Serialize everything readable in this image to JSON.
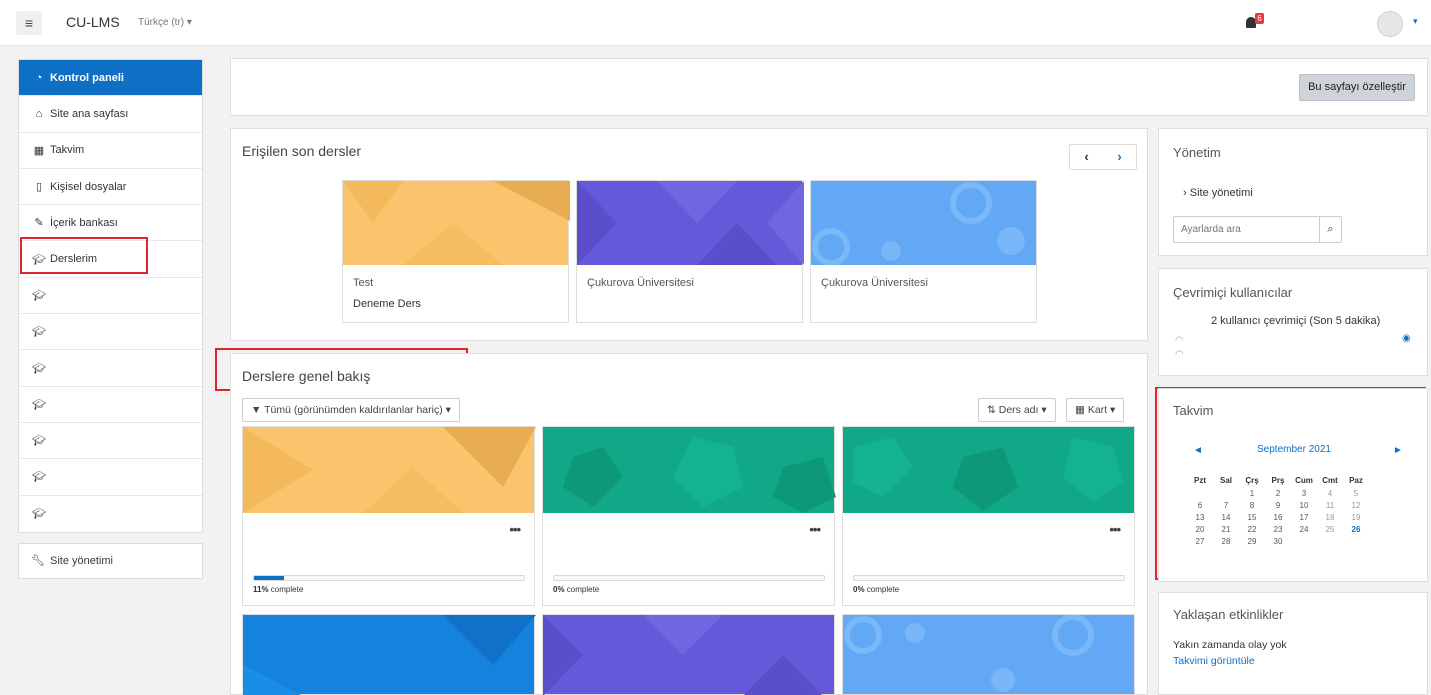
{
  "navbar": {
    "menu_icon": "hamburger-icon",
    "brand": "CU-LMS",
    "language": "Türkçe ‎(tr)‎",
    "language_caret": "▾",
    "notifications_count": "6",
    "user_caret": "▾"
  },
  "leftnav": {
    "dashboard": "Kontrol paneli",
    "items": [
      {
        "label": "Site ana sayfası",
        "icon": "home-icon"
      },
      {
        "label": "Takvim",
        "icon": "calendar-icon"
      },
      {
        "label": "Kişisel dosyalar",
        "icon": "file-icon"
      },
      {
        "label": "İçerik bankası",
        "icon": "brush-icon"
      },
      {
        "label": "Derslerim",
        "icon": "graduation-cap-icon"
      }
    ],
    "course_icon_count": 7,
    "site_admin": "Site yönetimi"
  },
  "customize_button": "Bu sayfayı özelleştir",
  "recent": {
    "title": "Erişilen son dersler",
    "prev": "‹",
    "next": "›",
    "courses": [
      {
        "category": "Test",
        "name": "Deneme Ders",
        "color": "#f9c46b"
      },
      {
        "category": "Çukurova Üniversitesi",
        "name": "",
        "color": "#6559d9"
      },
      {
        "category": "Çukurova Üniversitesi",
        "name": "",
        "color": "#62a8f5"
      }
    ]
  },
  "overview": {
    "title": "Derslere genel bakış",
    "filter": "Tümü (görünümden kaldırılanlar hariç)",
    "sort": "Ders adı",
    "view": "Kart",
    "courses": [
      {
        "color": "#f9c46b",
        "progress": 11,
        "pct_num": "11%",
        "pct_text": " complete"
      },
      {
        "color": "#10a886",
        "progress": 0,
        "pct_num": "0%",
        "pct_text": " complete"
      },
      {
        "color": "#10a886",
        "progress": 0,
        "pct_num": "0%",
        "pct_text": " complete"
      }
    ],
    "bottom_colors": [
      "#1582dd",
      "#6559d9",
      "#62a8f5"
    ]
  },
  "admin_block": {
    "title": "Yönetim",
    "link": "Site yönetimi",
    "search_placeholder": "Ayarlarda ara"
  },
  "online_block": {
    "title": "Çevrimiçi kullanıcılar",
    "text": "2 kullanıcı çevrimiçi (Son 5 dakika)"
  },
  "calendar_block": {
    "title": "Takvim",
    "month": "September 2021",
    "prev": "◄",
    "next": "►",
    "days": [
      "Pzt",
      "Sal",
      "Çrş",
      "Prş",
      "Cum",
      "Cmt",
      "Paz"
    ],
    "weeks": [
      [
        "",
        "",
        "1",
        "2",
        "3",
        "4",
        "5"
      ],
      [
        "6",
        "7",
        "8",
        "9",
        "10",
        "11",
        "12"
      ],
      [
        "13",
        "14",
        "15",
        "16",
        "17",
        "18",
        "19"
      ],
      [
        "20",
        "21",
        "22",
        "23",
        "24",
        "25",
        "26"
      ],
      [
        "27",
        "28",
        "29",
        "30",
        "",
        "",
        ""
      ]
    ],
    "today": "26"
  },
  "events_block": {
    "title": "Yaklaşan etkinlikler",
    "text": "Yakın zamanda olay yok",
    "link": "Takvimi görüntüle"
  }
}
